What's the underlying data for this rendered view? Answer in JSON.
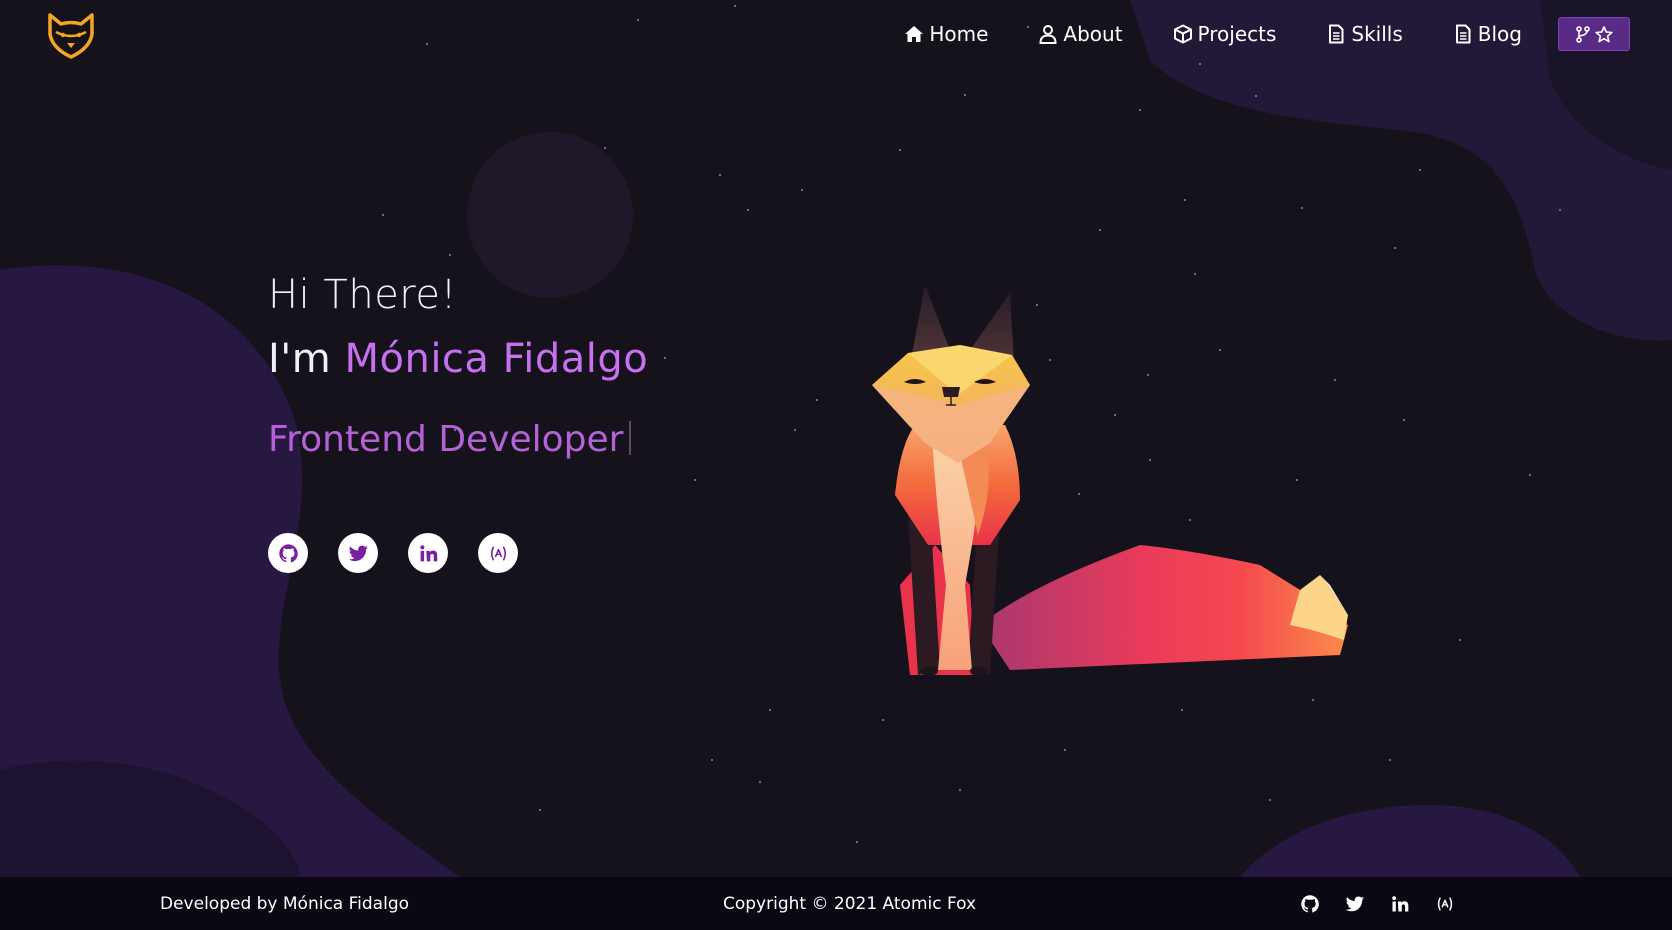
{
  "nav": {
    "logo_icon": "fox-head-icon",
    "items": [
      {
        "label": "Home",
        "icon": "home-icon"
      },
      {
        "label": "About",
        "icon": "user-icon"
      },
      {
        "label": "Projects",
        "icon": "cube-icon"
      },
      {
        "label": "Skills",
        "icon": "document-icon"
      },
      {
        "label": "Blog",
        "icon": "document-icon"
      }
    ],
    "fork_button_icons": [
      "code-fork-icon",
      "star-icon"
    ]
  },
  "hero": {
    "greeting": "Hi There!",
    "name_prefix": "I'm ",
    "name": "Mónica Fidalgo",
    "role": "Frontend Developer",
    "social_icons": [
      "github-icon",
      "twitter-icon",
      "linkedin-icon",
      "devto-icon"
    ]
  },
  "footer": {
    "developed_by": "Developed by Mónica Fidalgo",
    "copyright": "Copyright © 2021 Atomic Fox",
    "social_icons": [
      "github-icon",
      "twitter-icon",
      "linkedin-icon",
      "devto-icon"
    ]
  },
  "colors": {
    "background": "#15121c",
    "accent_purple": "#c770f0",
    "role_purple": "#b562d6",
    "logo_gold": "#f5a623",
    "footer_bg": "#0b0713",
    "fork_button": "#5a2b86"
  }
}
